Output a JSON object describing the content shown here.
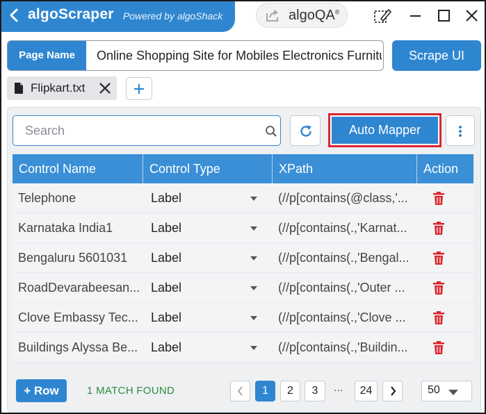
{
  "titlebar": {
    "app_name": "algoScraper",
    "powered_by": "Powered by algoShack",
    "qa_brand": "algoQA",
    "qa_reg": "®",
    "brand_color": "#2f86d0"
  },
  "page_name": {
    "label": "Page Name",
    "value": "Online Shopping Site for Mobiles Electronics Furniture"
  },
  "scrape_button": "Scrape UI",
  "file_tab": {
    "name": "Flipkart.txt"
  },
  "search": {
    "placeholder": "Search"
  },
  "auto_mapper": "Auto Mapper",
  "table": {
    "headers": [
      "Control Name",
      "Control Type",
      "XPath",
      "Action"
    ],
    "rows": [
      {
        "name": "Telephone",
        "type": "Label",
        "xpath": "(//p[contains(@class,'..."
      },
      {
        "name": "Karnataka India1",
        "type": "Label",
        "xpath": "(//p[contains(.,'Karnat..."
      },
      {
        "name": "Bengaluru 5601031",
        "type": "Label",
        "xpath": "(//p[contains(.,'Bengal..."
      },
      {
        "name": "RoadDevarabeesan...",
        "type": "Label",
        "xpath": "(//p[contains(.,'Outer ..."
      },
      {
        "name": "Clove Embassy Tec...",
        "type": "Label",
        "xpath": "(//p[contains(.,'Clove ..."
      },
      {
        "name": "Buildings Alyssa Be...",
        "type": "Label",
        "xpath": "(//p[contains(.,'Buildin..."
      }
    ]
  },
  "footer": {
    "add_row": "+ Row",
    "match_text": "1 MATCH FOUND",
    "pages": [
      "1",
      "2",
      "3",
      "24"
    ],
    "ellipsis": "...",
    "current_page": "1",
    "page_size": "50"
  },
  "colors": {
    "accent": "#2f86d0",
    "header": "#3a8fd6",
    "delete": "#d9272e",
    "match": "#2e8b3d",
    "highlight_border": "#d9272e"
  }
}
